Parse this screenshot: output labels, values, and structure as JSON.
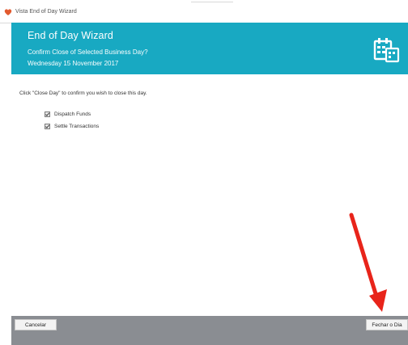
{
  "window": {
    "title": "Vista End of Day Wizard"
  },
  "header": {
    "title": "End of Day Wizard",
    "subtitle": "Confirm Close of Selected Business Day?",
    "date": "Wednesday 15 November 2017",
    "icon": "calendar-icon"
  },
  "main": {
    "instruction": "Click \"Close Day\" to confirm you wish to close this day.",
    "options": [
      {
        "label": "Dispatch Funds",
        "checked": true
      },
      {
        "label": "Settle Transactions",
        "checked": true
      }
    ]
  },
  "footer": {
    "cancel_label": "Cancelar",
    "close_day_label": "Fechar o Dia"
  },
  "colors": {
    "header_bg": "#18a9c2",
    "footer_bg": "#8a8d92",
    "annotation_arrow": "#e8241a"
  }
}
